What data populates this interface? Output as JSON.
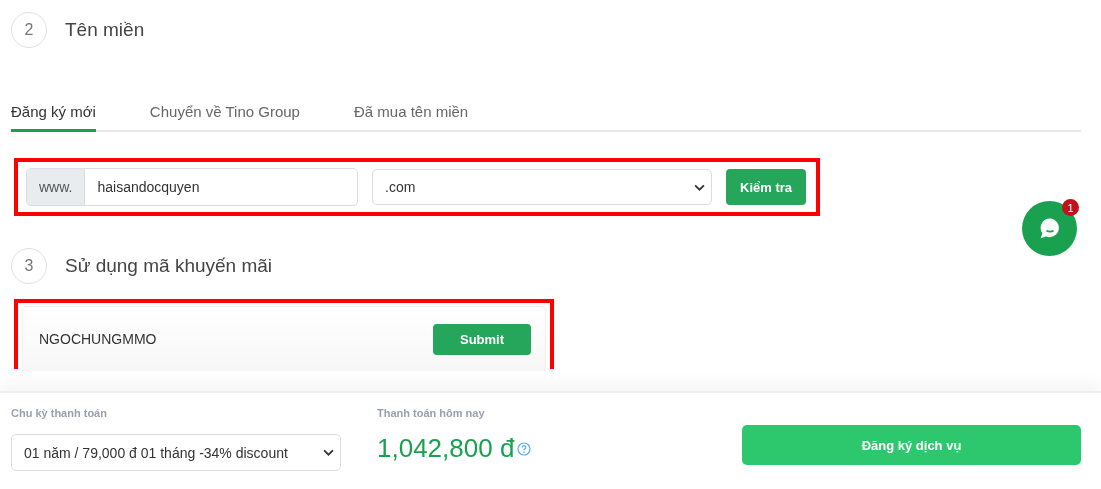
{
  "domain_section": {
    "step": "2",
    "title": "Tên miền",
    "tabs": [
      {
        "label": "Đăng ký mới",
        "selected": true
      },
      {
        "label": "Chuyển về Tino Group",
        "selected": false
      },
      {
        "label": "Đã mua tên miền",
        "selected": false
      }
    ],
    "highlighted": true,
    "prefix": "www.",
    "domain": "haisandocquyen",
    "tld": ".com",
    "check_button": "Kiểm tra"
  },
  "promo_section": {
    "step": "3",
    "title": "Sử dụng mã khuyến mãi",
    "highlighted": true,
    "code": "NGOCHUNGMMO",
    "submit_button": "Submit"
  },
  "footer": {
    "cycle_label": "Chu kỳ thanh toán",
    "cycle_value": "01 năm / 79,000 đ 01 tháng -34% discount",
    "total_label": "Thanh toán hôm nay",
    "total": "1,042,800 đ",
    "order_button": "Đăng ký dịch vụ"
  },
  "chat": {
    "badge": "1"
  }
}
